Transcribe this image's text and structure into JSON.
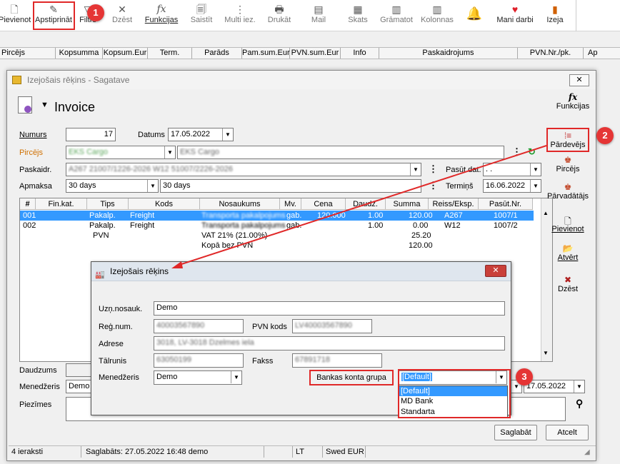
{
  "toolbar": {
    "items": [
      {
        "label": "Pievienot",
        "icon": "new-doc-icon"
      },
      {
        "label": "Apstiprināt",
        "icon": "approve-icon"
      },
      {
        "label": "Filtrs",
        "icon": "filter-icon"
      },
      {
        "label": "Dzēst",
        "icon": "delete-icon"
      },
      {
        "label": "Funkcijas",
        "icon": "function-icon"
      },
      {
        "label": "Saistīt",
        "icon": "link-icon"
      },
      {
        "label": "Multi iez.",
        "icon": "multi-icon"
      },
      {
        "label": "Drukāt",
        "icon": "print-icon"
      },
      {
        "label": "Mail",
        "icon": "mail-icon"
      },
      {
        "label": "Skats",
        "icon": "view-icon"
      },
      {
        "label": "Grāmatot",
        "icon": "book-icon"
      },
      {
        "label": "Kolonnas",
        "icon": "columns-icon"
      },
      {
        "label": "",
        "icon": "bell-icon"
      },
      {
        "label": "Mani darbi",
        "icon": "heart-icon"
      },
      {
        "label": "Izeja",
        "icon": "exit-icon"
      }
    ]
  },
  "list_columns": [
    "Pircējs",
    "Kopsumma",
    "Kopsum.Eur",
    "Term.",
    "Parāds",
    "Pam.sum.Eur",
    "PVN.sum.Eur",
    "Info",
    "Paskaidrojums",
    "PVN.Nr./pk.",
    "Ap"
  ],
  "window": {
    "title": "Izejošais rēķins - Sagatave",
    "heading": "Invoice",
    "functions_label": "Funkcijas"
  },
  "form": {
    "numurs_label": "Numurs",
    "numurs_value": "17",
    "datums_label": "Datums",
    "datums_value": "17.05.2022",
    "pircejs_label": "Pircējs",
    "pircejs_code": "EKS Cargo",
    "pircejs_name": "EKS Cargo",
    "paskaidr_label": "Paskaidr.",
    "paskaidr_value": "A267 21007/1226-2026 W12 51007/2226-2026",
    "pasut_dat_label": "Pasūt.dat.",
    "pasut_dat_value": ". .",
    "apmaksa_label": "Apmaksa",
    "apmaksa_value": "30 days",
    "apmaksa_text": "30 days",
    "termins_label": "Termiņš",
    "termins_value": "16.06.2022",
    "daudzums_label": "Daudzums",
    "menedzeris_label": "Menedžeris",
    "menedzeris_value": "Demo",
    "date2_value": "17.05.2022",
    "piezimes_label": "Piezīmes"
  },
  "grid": {
    "columns": [
      "#",
      "Fin.kat.",
      "Tips",
      "Kods",
      "Nosaukums",
      "Mv.",
      "Cena",
      "Daudz.",
      "Summa",
      "Reiss/Eksp.",
      "Pasūt.Nr."
    ],
    "rows": [
      {
        "n": "001",
        "tips": "Pakalp.",
        "kods": "Freight",
        "nos": "Transporta pakalpojums",
        "mv": "gab.",
        "cena": "120.000",
        "daudz": "1.00",
        "summa": "120.00",
        "reiss": "A267",
        "pasut": "1007/1"
      },
      {
        "n": "002",
        "tips": "Pakalp.",
        "kods": "Freight",
        "nos": "Transporta pakalpojums",
        "mv": "gab.",
        "cena": "",
        "daudz": "1.00",
        "summa": "0.00",
        "reiss": "W12",
        "pasut": "1007/2"
      },
      {
        "n": "",
        "tips": "PVN",
        "kods": "",
        "nos": "VAT 21% (21.00%)",
        "mv": "",
        "cena": "",
        "daudz": "",
        "summa": "25.20",
        "reiss": "",
        "pasut": ""
      },
      {
        "n": "",
        "tips": "",
        "kods": "",
        "nos": "Kopā bez PVN",
        "mv": "",
        "cena": "",
        "daudz": "",
        "summa": "120.00",
        "reiss": "",
        "pasut": ""
      }
    ]
  },
  "side_buttons": [
    {
      "label": "Pārdevējs",
      "icon": "seller-icon"
    },
    {
      "label": "Pircējs",
      "icon": "buyer-icon"
    },
    {
      "label": "Pārvadātājs",
      "icon": "carrier-icon"
    },
    {
      "label": "Pievienot",
      "icon": "add-icon"
    },
    {
      "label": "Atvērt",
      "icon": "open-icon"
    },
    {
      "label": "Dzēst",
      "icon": "delete-icon"
    }
  ],
  "dialog": {
    "title": "Izejošais rēķins",
    "uzn_label": "Uzņ.nosauk.",
    "uzn_value": "Demo",
    "reg_label": "Reģ.num.",
    "reg_value": "40003567890",
    "pvn_label": "PVN kods",
    "pvn_value": "LV40003567890",
    "adrese_label": "Adrese",
    "adrese_value": "3018, LV-3018 Dzelmes iela",
    "talr_label": "Tālrunis",
    "talr_value": "63050199",
    "fakss_label": "Fakss",
    "fakss_value": "67891718",
    "men_label": "Menedžeris",
    "men_value": "Demo",
    "bank_label": "Bankas konta grupa",
    "bank_value": "[Default]",
    "bank_options": [
      "[Default]",
      "MD Bank",
      "Standarta"
    ]
  },
  "buttons": {
    "save": "Saglabāt",
    "cancel": "Atcelt"
  },
  "status": {
    "count": "4 ieraksti",
    "saved": "Saglabāts: 27.05.2022 16:48 demo",
    "lang": "LT",
    "bank": "Swed EUR"
  },
  "badges": [
    "1",
    "2",
    "3"
  ],
  "colors": {
    "highlight": "#3399ff",
    "annotation": "#e02828"
  }
}
